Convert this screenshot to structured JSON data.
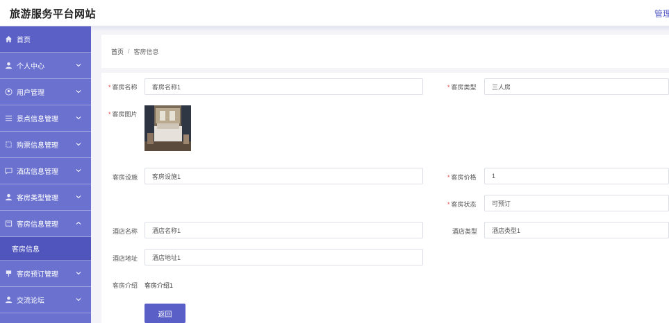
{
  "header": {
    "site_title": "旅游服务平台网站",
    "admin_link": "管理"
  },
  "sidebar": {
    "items": [
      {
        "label": "首页",
        "icon": "home-icon"
      },
      {
        "label": "个人中心",
        "icon": "user-icon"
      },
      {
        "label": "用户管理",
        "icon": "circle-user-icon"
      },
      {
        "label": "景点信息管理",
        "icon": "list-icon"
      },
      {
        "label": "购票信息管理",
        "icon": "ticket-icon"
      },
      {
        "label": "酒店信息管理",
        "icon": "chat-icon"
      },
      {
        "label": "客房类型管理",
        "icon": "user-icon"
      },
      {
        "label": "客房信息管理",
        "icon": "document-icon"
      },
      {
        "label": "客房预订管理",
        "icon": "flag-icon"
      },
      {
        "label": "交流论坛",
        "icon": "user-icon"
      }
    ],
    "subitem": "客房信息"
  },
  "breadcrumb": {
    "home": "首页",
    "separator": "/",
    "current": "客房信息"
  },
  "form": {
    "room_name": {
      "label": "客房名称",
      "value": "客房名称1"
    },
    "room_type": {
      "label": "客房类型",
      "value": "三人房"
    },
    "room_image": {
      "label": "客房图片"
    },
    "facilities": {
      "label": "客房设施",
      "value": "客房设施1"
    },
    "price": {
      "label": "客房价格",
      "value": "1"
    },
    "status": {
      "label": "客房状态",
      "value": "可预订"
    },
    "hotel_name": {
      "label": "酒店名称",
      "value": "酒店名称1"
    },
    "hotel_type": {
      "label": "酒店类型",
      "value": "酒店类型1"
    },
    "hotel_address": {
      "label": "酒店地址",
      "value": "酒店地址1"
    },
    "intro": {
      "label": "客房介绍",
      "value": "客房介绍1"
    },
    "required_mark": "*",
    "back_button": "返回"
  },
  "colors": {
    "sidebar": "#6b71cf",
    "accent": "#5a5fc7",
    "required": "#e24c4c"
  }
}
